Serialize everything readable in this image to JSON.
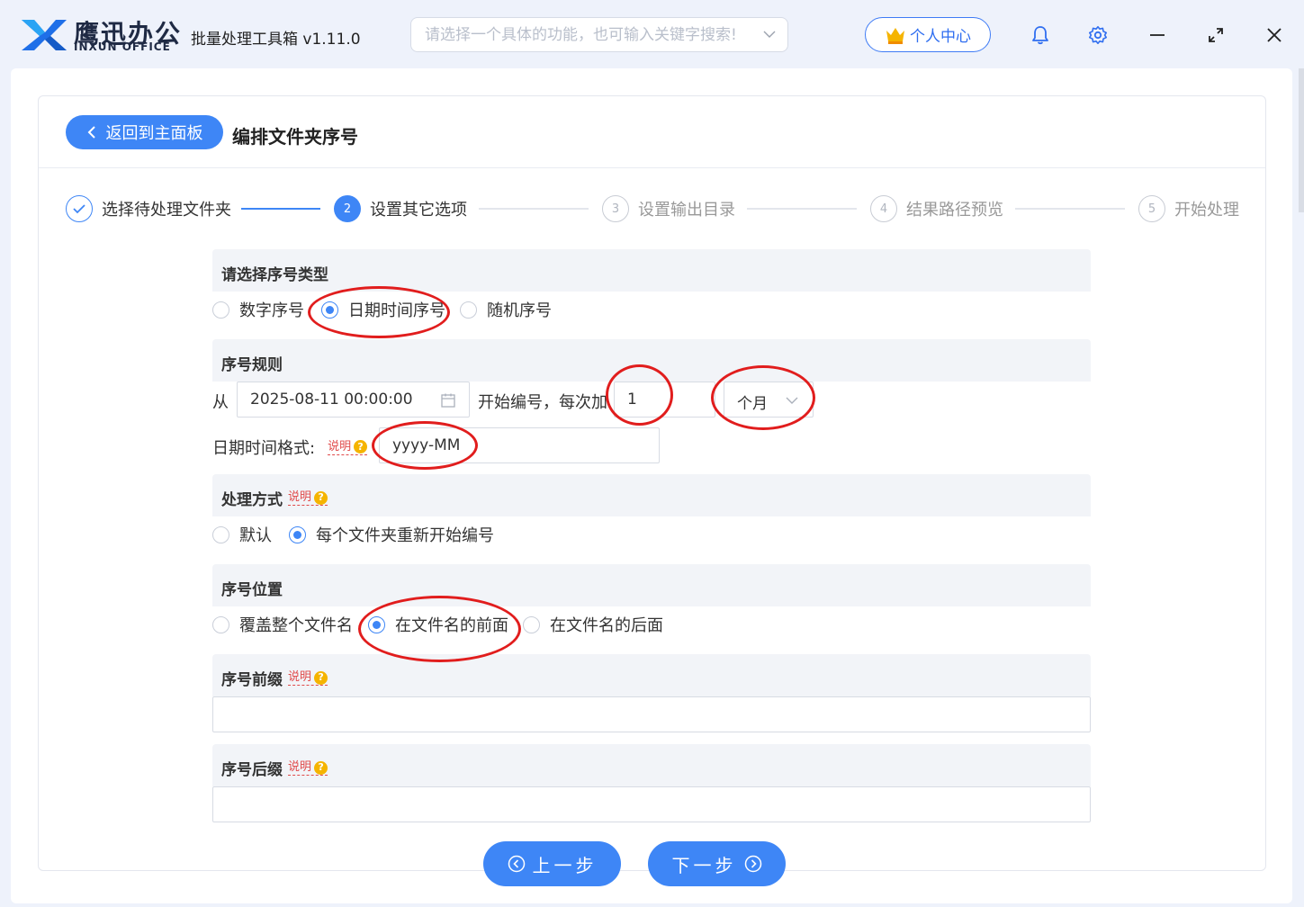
{
  "app": {
    "logo_cn": "鹰迅办公",
    "logo_en": "INXUN OFFICE",
    "title": "批量处理工具箱 v1.11.0",
    "search_placeholder": "请选择一个具体的功能，也可输入关键字搜索!",
    "personal_center": "个人中心",
    "brand_color": "#3e86f6"
  },
  "page": {
    "back_button": "返回到主面板",
    "title": "编排文件夹序号"
  },
  "steps": [
    {
      "num": "✓",
      "label": "选择待处理文件夹",
      "state": "done"
    },
    {
      "num": "2",
      "label": "设置其它选项",
      "state": "active"
    },
    {
      "num": "3",
      "label": "设置输出目录",
      "state": "todo"
    },
    {
      "num": "4",
      "label": "结果路径预览",
      "state": "todo"
    },
    {
      "num": "5",
      "label": "开始处理",
      "state": "todo"
    }
  ],
  "sections": {
    "seq_type": {
      "title": "请选择序号类型",
      "options": [
        "数字序号",
        "日期时间序号",
        "随机序号"
      ],
      "selected": "日期时间序号"
    },
    "seq_rule": {
      "title": "序号规则",
      "from_label": "从",
      "start_value": "2025-08-11 00:00:00",
      "mid_label": "开始编号，每次加",
      "increment": "1",
      "unit": "个月",
      "format_label": "日期时间格式:",
      "format_value": "yyyy-MM"
    },
    "process_mode": {
      "title": "处理方式",
      "options": [
        "默认",
        "每个文件夹重新开始编号"
      ],
      "selected": "每个文件夹重新开始编号"
    },
    "seq_position": {
      "title": "序号位置",
      "options": [
        "覆盖整个文件名",
        "在文件名的前面",
        "在文件名的后面"
      ],
      "selected": "在文件名的前面"
    },
    "prefix": {
      "title": "序号前缀",
      "value": ""
    },
    "suffix": {
      "title": "序号后缀",
      "value": ""
    }
  },
  "hint_label": "说明",
  "hint_icon": "?",
  "nav": {
    "prev": "上一步",
    "next": "下一步"
  },
  "annotation_color": "#e11d1d",
  "icons": [
    "logo-icon",
    "chevron-down-icon",
    "crown-icon",
    "bell-icon",
    "gear-icon",
    "minimize-icon",
    "maximize-icon",
    "close-icon",
    "chevron-left-icon",
    "check-icon",
    "calendar-icon",
    "help-icon",
    "arrow-left-circle-icon",
    "arrow-right-circle-icon"
  ]
}
